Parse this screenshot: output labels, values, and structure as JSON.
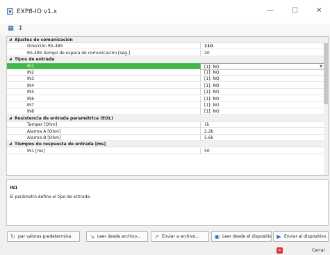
{
  "window": {
    "title": "EXP8-IO v1.x",
    "minimize": "—",
    "maximize": "☐",
    "close": "✕"
  },
  "toolbar": {
    "categorized_glyph": "▦",
    "sort_glyph": "↕"
  },
  "grid": {
    "categories": [
      {
        "label": "Ajustes de comunicación",
        "rows": [
          {
            "name": "Dirección RS-485",
            "value": "110",
            "bold": true
          },
          {
            "name": "RS-485 tiempo de espera de comunicación [seg.]",
            "value": "20"
          }
        ]
      },
      {
        "label": "Tipos de entrada",
        "rows": [
          {
            "name": "IN1",
            "value": "[1]: NO",
            "selected": true
          },
          {
            "name": "IN2",
            "value": "[1]: NO"
          },
          {
            "name": "IN3",
            "value": "[1]: NO"
          },
          {
            "name": "IN4",
            "value": "[1]: NO"
          },
          {
            "name": "IN5",
            "value": "[1]: NO"
          },
          {
            "name": "IN6",
            "value": "[1]: NO"
          },
          {
            "name": "IN7",
            "value": "[1]: NO"
          },
          {
            "name": "IN8",
            "value": "[1]: NO"
          }
        ]
      },
      {
        "label": "Resistencia de entrada paramétrica (EOL)",
        "rows": [
          {
            "name": "Tamper [Ohm]",
            "value": "1k"
          },
          {
            "name": "Alarma A [Ohm]",
            "value": "2.2k"
          },
          {
            "name": "Alarma B [Ohm]",
            "value": "5.6k"
          }
        ]
      },
      {
        "label": "Tiempos de respuesta de entrada [ms]",
        "rows": [
          {
            "name": "IN1 [ms]",
            "value": "50"
          }
        ]
      }
    ]
  },
  "description": {
    "title": "IN1",
    "text": "El parámetro define el tipo de entrada."
  },
  "buttons": [
    {
      "label": "par valores predetermina",
      "icon": "reset-icon",
      "glyph": "↻"
    },
    {
      "label": "Leer desde archivo...",
      "icon": "read-file-icon",
      "glyph": "↘"
    },
    {
      "label": "Enviar a archivo...",
      "icon": "send-file-icon",
      "glyph": "↗"
    },
    {
      "label": "Leer desde el dispositivo",
      "icon": "read-device-icon",
      "glyph": "▣"
    },
    {
      "label": "Enviar al dispositivo",
      "icon": "send-device-icon",
      "glyph": "▶"
    }
  ],
  "close_button": {
    "label": "Cerrar",
    "glyph": "✕"
  },
  "colors": {
    "selected_row": "#3fb844",
    "close_icon": "#dd3333"
  }
}
